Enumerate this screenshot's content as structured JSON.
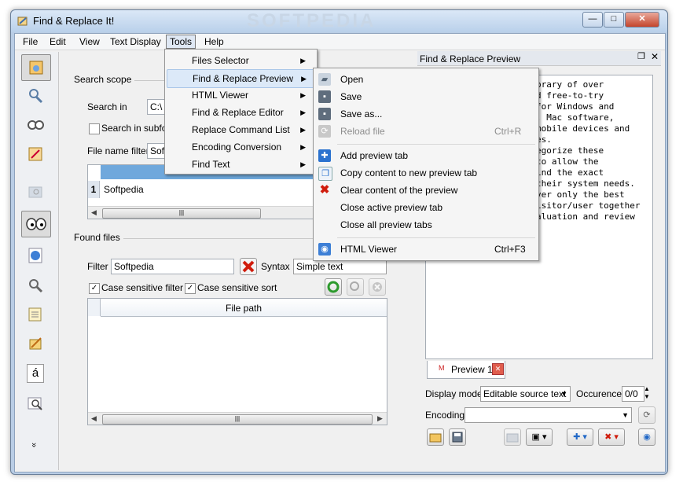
{
  "window": {
    "title": "Find & Replace It!",
    "watermark": "SOFTPEDIA",
    "controls": {
      "minimize": "—",
      "maximize": "□",
      "close": "✕"
    }
  },
  "menubar": [
    "File",
    "Edit",
    "View",
    "Text Display",
    "Tools",
    "Help"
  ],
  "left_toolbar_icons": [
    "find-files-icon",
    "find-replace-icon",
    "search-icon",
    "replace-icon",
    "disabled-search-icon",
    "preview-eyes-icon",
    "html-viewer-icon",
    "command-list-icon",
    "text-editor-icon",
    "encoding-icon",
    "special-char-icon",
    "find-text-icon",
    "more-icon"
  ],
  "left_toolbar_glyphs": {
    "special_char": "á",
    "more": "»"
  },
  "search_scope": {
    "legend": "Search scope",
    "search_in_label": "Search in",
    "search_in_value": "C:\\",
    "subfolders_label": "Search in subfolders",
    "name_filter_label": "File name filter",
    "name_filter_value": "Sof",
    "grid_row_num": "1",
    "grid_row_value": "Softpedia",
    "scroll_left": "◀",
    "scroll_right": "▶",
    "thumb": "|||"
  },
  "found_files": {
    "legend": "Found files",
    "filter_label": "Filter",
    "filter_value": "Softpedia",
    "syntax_label": "Syntax",
    "syntax_value": "Simple text",
    "case_filter_label": "Case sensitive filter",
    "case_sort_label": "Case sensitive sort",
    "column_header": "File path",
    "checkmark": "✓"
  },
  "tools_menu": [
    {
      "label": "Files Selector"
    },
    {
      "label": "Find & Replace Preview"
    },
    {
      "label": "HTML Viewer"
    },
    {
      "label": "Find & Replace Editor"
    },
    {
      "label": "Replace Command List"
    },
    {
      "label": "Encoding Conversion"
    },
    {
      "label": "Find Text"
    }
  ],
  "submenu_arrow": "▶",
  "preview_submenu": [
    {
      "label": "Open",
      "shortcut": "",
      "icon": "open-folder-icon",
      "enabled": true
    },
    {
      "label": "Save",
      "shortcut": "",
      "icon": "save-disk-icon",
      "enabled": true
    },
    {
      "label": "Save as...",
      "shortcut": "",
      "icon": "save-as-disk-icon",
      "enabled": true
    },
    {
      "label": "Reload file",
      "shortcut": "Ctrl+R",
      "icon": "reload-icon",
      "enabled": false
    },
    {
      "label": "Add preview tab",
      "shortcut": "",
      "icon": "add-tab-icon",
      "enabled": true
    },
    {
      "label": "Copy content to new preview tab",
      "shortcut": "",
      "icon": "copy-content-icon",
      "enabled": true
    },
    {
      "label": "Clear content of the preview",
      "shortcut": "",
      "icon": "clear-red-x-icon",
      "enabled": true
    },
    {
      "label": "Close active preview tab",
      "shortcut": "",
      "icon": "",
      "enabled": true
    },
    {
      "label": "Close all preview tabs",
      "shortcut": "",
      "icon": "",
      "enabled": true
    },
    {
      "label": "HTML Viewer",
      "shortcut": "Ctrl+F3",
      "icon": "html-viewer-icon",
      "enabled": true
    }
  ],
  "preview_panel": {
    "title": "Find & Replace Preview",
    "text_lines": [
      "brary of over",
      "d free-to-try",
      " for Windows and",
      ", Mac software,",
      "mobile devices and",
      "es.",
      "egorize these",
      "to allow the",
      "ind the exact",
      "their system needs.",
      "ver only the best",
      "isitor/user together",
      "aluation and review"
    ],
    "tab_label": "Preview 1",
    "display_mode_label": "Display mode",
    "display_mode_value": "Editable source text",
    "occurence_label": "Occurence",
    "occurence_value": "0/0",
    "encoding_label": "Encoding",
    "encoding_value": ""
  }
}
